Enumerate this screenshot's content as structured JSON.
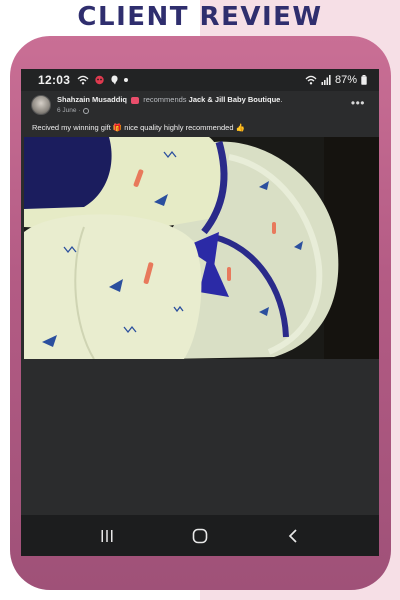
{
  "banner": {
    "title": "CLIENT REVIEW"
  },
  "status_bar": {
    "time": "12:03",
    "battery": "87%"
  },
  "post": {
    "author": "Shahzain Musaddiq",
    "action": "recommends",
    "page": "Jack & Jill Baby Boutique",
    "page_suffix": ".",
    "date": "6 June",
    "text": "Recived my winning gift 🎁 nice quality highly recommended 👍",
    "more": "•••"
  },
  "icons": {
    "wifi": "wifi-icon",
    "notification": "notification-icon",
    "chat": "chat-icon",
    "signal": "signal-icon",
    "battery": "battery-icon",
    "globe": "globe-icon",
    "recents": "recents-icon",
    "home": "home-icon",
    "back": "back-icon"
  },
  "colors": {
    "banner_text": "#2f2e6e",
    "frame": "#b35b84",
    "screen": "#2b2c2d",
    "nav_bar": "#1c1d1e"
  }
}
